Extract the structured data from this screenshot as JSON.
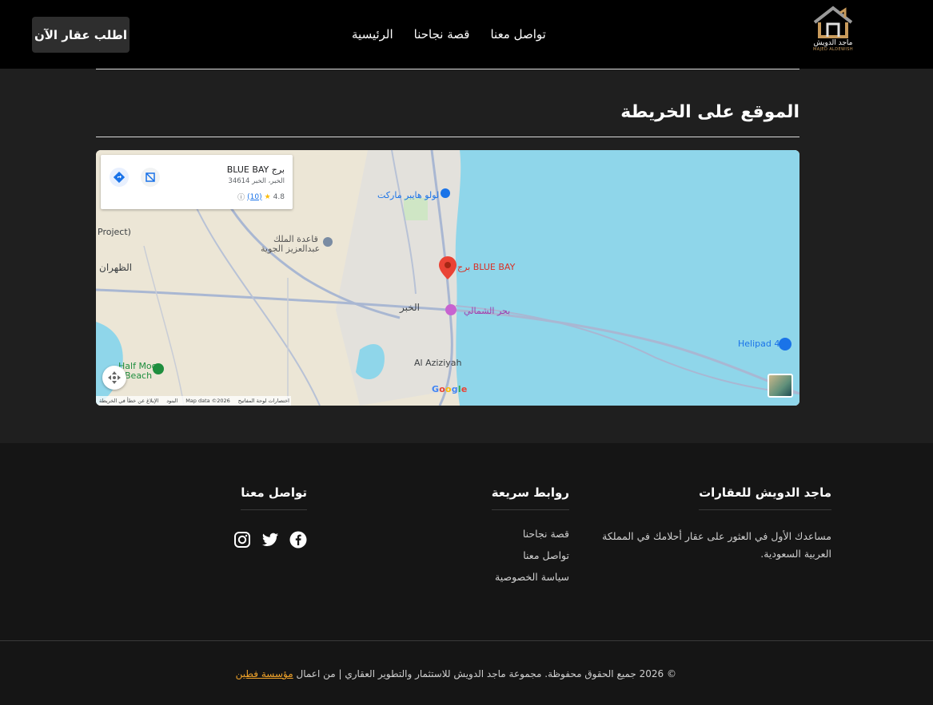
{
  "header": {
    "cta_label": "اطلب عقار الآن",
    "nav": [
      "الرئيسية",
      "قصة نجاحنا",
      "تواصل معنا"
    ],
    "logo": {
      "name_ar": "ماجد الدويش",
      "name_en": "MAJED ALDEWISH",
      "accent": "#c89a5b"
    }
  },
  "map_section": {
    "title": "الموقع على الخريطة",
    "card": {
      "title": "برج BLUE BAY",
      "address": "الخبر، الخبر 34614",
      "rating": "4.8",
      "reviews": "(10)"
    },
    "labels": {
      "pin": "برج BLUE BAY",
      "lulu": "لولو هايبر ماركت",
      "airbase_1": "قاعدة الملك",
      "airbase_2": "عبدالعزيز الجوية",
      "dhahran": "الظهران",
      "khobar": "الخبر",
      "corniche": "بحر الشمالي",
      "aziziyah": "Al Aziziyah",
      "half_moon_1": "Half Moon",
      "half_moon_2": "Beach",
      "project": "Project)",
      "helipad": "Helipad 4",
      "google": "Google"
    },
    "attribution": [
      "الإبلاغ عن خطأ في الخريطة",
      "البنود",
      "Map data ©2026",
      "اختصارات لوحة المفاتيح"
    ]
  },
  "footer": {
    "about": {
      "title": "ماجد الدويش للعقارات",
      "text": "مساعدك الأول في العثور على عقار أحلامك في المملكة العربية السعودية."
    },
    "links": {
      "title": "روابط سريعة",
      "items": [
        "قصة نجاحنا",
        "تواصل معنا",
        "سياسة الخصوصية"
      ]
    },
    "contact": {
      "title": "تواصل معنا",
      "icons": [
        "facebook-icon",
        "twitter-icon",
        "instagram-icon"
      ]
    },
    "copyright_text": "© 2026 جميع الحقوق محفوظة. مجموعة ماجد الدويش للاستثمار والتطوير العقاري | من اعمال",
    "copyright_link": "مؤسسة فطين",
    "link_color": "#f0a32a"
  }
}
